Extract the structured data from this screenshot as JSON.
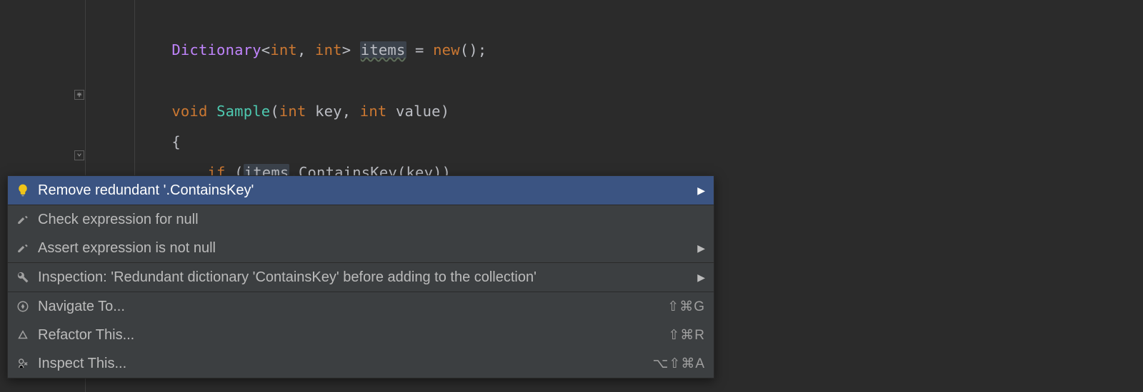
{
  "code": {
    "line1": {
      "indent": "    ",
      "type": "Dictionary",
      "generic_open": "<",
      "int1": "int",
      "comma": ", ",
      "int2": "int",
      "generic_close": "> ",
      "var": "items",
      "assign": " = ",
      "new_kw": "new",
      "parens": "();"
    },
    "line3": {
      "indent": "    ",
      "void_kw": "void",
      "space": " ",
      "fn": "Sample",
      "open": "(",
      "int1": "int",
      "sp1": " ",
      "p1": "key",
      "comma": ", ",
      "int2": "int",
      "sp2": " ",
      "p2": "value",
      "close": ")"
    },
    "line4": {
      "indent": "    ",
      "brace": "{"
    },
    "line5": {
      "indent": "        ",
      "if_kw": "if",
      "sp": " ",
      "open": "(",
      "var": "items",
      "dot": ".",
      "method": "ContainsKey",
      "open2": "(",
      "arg": "key",
      "close": "))"
    }
  },
  "menu": {
    "items": [
      {
        "label": "Remove redundant '.ContainsKey'",
        "icon": "lightbulb",
        "selected": true,
        "submenu": true
      },
      {
        "label": "Check expression for null",
        "icon": "hammer"
      },
      {
        "label": "Assert expression is not null",
        "icon": "hammer",
        "submenu": true
      },
      {
        "label": "Inspection: 'Redundant dictionary 'ContainsKey' before adding to the collection'",
        "icon": "wrench",
        "submenu": true,
        "separator_before": true
      },
      {
        "label": "Navigate To...",
        "icon": "compass",
        "shortcut": "⇧⌘G",
        "separator_before": true
      },
      {
        "label": "Refactor This...",
        "icon": "pyramid",
        "shortcut": "⇧⌘R"
      },
      {
        "label": "Inspect This...",
        "icon": "inspect",
        "shortcut": "⌥⇧⌘A"
      }
    ]
  }
}
